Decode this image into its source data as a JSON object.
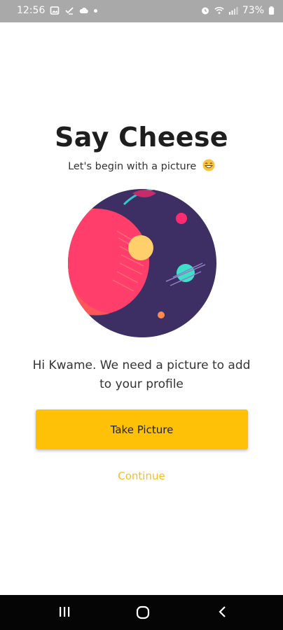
{
  "status_bar": {
    "time": "12:56",
    "battery": "73%",
    "icons": [
      "image-icon",
      "check-icon",
      "cloud-icon",
      "dot",
      "alarm-icon",
      "wifi-icon",
      "signal-icon",
      "battery-icon"
    ]
  },
  "page": {
    "title": "Say Cheese",
    "subtitle": "Let's begin with a picture",
    "message": "Hi Kwame. We need a picture to add to your profile",
    "take_picture_label": "Take Picture",
    "continue_label": "Continue"
  },
  "nav_bar": {
    "buttons": [
      "recent-apps",
      "home",
      "back"
    ]
  },
  "colors": {
    "accent": "#ffc107",
    "link": "#f5bf23",
    "title": "#1e1e1e",
    "text": "#333333",
    "status_bar": "#a9a9a9",
    "nav_bar": "#050505",
    "space_bg": "#3d2f63",
    "planet": "#ff3e6c"
  }
}
